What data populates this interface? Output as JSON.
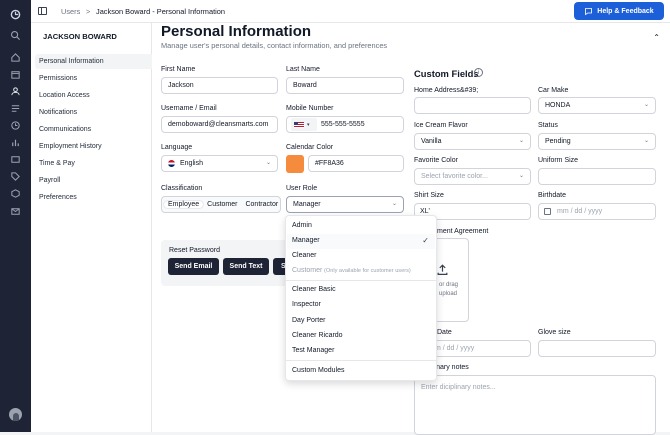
{
  "breadcrumb": {
    "root": "Users",
    "sep": ">",
    "current": "Jackson Boward - Personal Information"
  },
  "help_button": "Help & Feedback",
  "sidebar": {
    "name": "JACKSON BOWARD",
    "items": [
      {
        "label": "Personal Information",
        "active": true
      },
      {
        "label": "Permissions"
      },
      {
        "label": "Location Access"
      },
      {
        "label": "Notifications"
      },
      {
        "label": "Communications"
      },
      {
        "label": "Employment History"
      },
      {
        "label": "Time & Pay"
      },
      {
        "label": "Payroll"
      },
      {
        "label": "Preferences"
      }
    ]
  },
  "page": {
    "title": "Personal Information",
    "subtitle": "Manage user's personal details, contact information, and preferences"
  },
  "form": {
    "first_name": {
      "label": "First Name",
      "value": "Jackson"
    },
    "last_name": {
      "label": "Last Name",
      "value": "Boward"
    },
    "username": {
      "label": "Username / Email",
      "value": "demoboward@cleansmarts.com"
    },
    "mobile": {
      "label": "Mobile Number",
      "value": "555-555-5555"
    },
    "language": {
      "label": "Language",
      "value": "English"
    },
    "calendar_color": {
      "label": "Calendar Color",
      "value": "#FF8A36",
      "swatch": "#f58b3c"
    },
    "classification": {
      "label": "Classification",
      "options": [
        "Employee",
        "Customer",
        "Contractor"
      ]
    },
    "user_role": {
      "label": "User Role",
      "value": "Manager"
    }
  },
  "reset": {
    "title": "Reset Password",
    "send_email": "Send Email",
    "send_text": "Send Text",
    "third": "S"
  },
  "dropdown": {
    "options": [
      "Admin",
      "Manager",
      "Cleaner"
    ],
    "customer": "Customer",
    "customer_note": "(Only available for customer users)",
    "extra": [
      "Cleaner Basic",
      "Inspector",
      "Day Porter",
      "Cleaner Ricardo",
      "Test Manager"
    ],
    "custom": "Custom Modules",
    "selected": "Manager"
  },
  "custom_fields": {
    "title": "Custom Fields",
    "home_address": "Home Address&#39;",
    "car_make": {
      "label": "Car Make",
      "value": "HONDA"
    },
    "ice_cream": {
      "label": "Ice Cream Flavor",
      "value": "Vanilla"
    },
    "status": {
      "label": "Status",
      "value": "Pending"
    },
    "fav_color": {
      "label": "Favorite Color",
      "placeholder": "Select favorite color..."
    },
    "uniform": "Uniform Size",
    "shirt": {
      "label": "Shirt Size",
      "value": "XL'"
    },
    "birthdate": {
      "label": "Birthdate",
      "placeholder": "mm / dd / yyyy"
    },
    "agreement": "ment Agreement",
    "upload_text1": "or drag",
    "upload_text2": "upload",
    "date_label": "Date",
    "date_placeholder": "m / dd / yyyy",
    "glove": "Glove size",
    "notes_label": "iinary notes",
    "notes_placeholder": "Enter diciplinary notes..."
  },
  "colors": {
    "accent": "#1d5fd8",
    "rail": "#1e2336",
    "dark_button": "#1e2336"
  }
}
